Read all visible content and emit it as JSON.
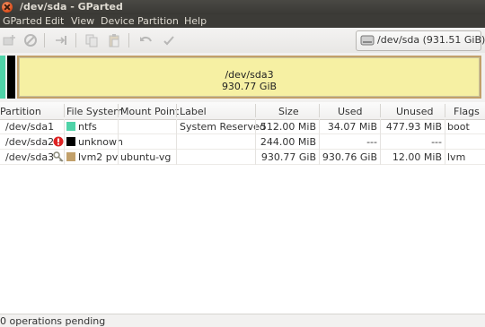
{
  "window": {
    "title": "/dev/sda - GParted"
  },
  "menu": [
    "GParted",
    "Edit",
    "View",
    "Device",
    "Partition",
    "Help"
  ],
  "toolbar": {
    "icons": [
      "new-partition-icon",
      "delete-icon",
      "resize-move-icon",
      "copy-icon",
      "paste-icon",
      "undo-icon",
      "apply-icon"
    ],
    "device_selector": "/dev/sda   (931.51 GiB)"
  },
  "disk_graphic": {
    "main_label": "/dev/sda3",
    "main_size": "930.77 GiB",
    "colors": {
      "ntfs": "#4fd3a8",
      "unknown": "#000000",
      "lvm2": "#c2a06a",
      "used_fill": "#f6f0a3"
    }
  },
  "table": {
    "headers": [
      "Partition",
      "File System",
      "Mount Point",
      "Label",
      "Size",
      "Used",
      "Unused",
      "Flags"
    ],
    "rows": [
      {
        "partition": "/dev/sda1",
        "status_icon": "",
        "fs_color": "#4fd3a8",
        "filesystem": "ntfs",
        "mount": "",
        "label": "System Reserved",
        "size": "512.00 MiB",
        "used": "34.07 MiB",
        "unused": "477.93 MiB",
        "flags": "boot"
      },
      {
        "partition": "/dev/sda2",
        "status_icon": "error-icon",
        "fs_color": "#000000",
        "filesystem": "unknown",
        "mount": "",
        "label": "",
        "size": "244.00 MiB",
        "used": "---",
        "unused": "---",
        "flags": ""
      },
      {
        "partition": "/dev/sda3",
        "status_icon": "key-icon",
        "fs_color": "#c2a06a",
        "filesystem": "lvm2 pv",
        "mount": "ubuntu-vg",
        "label": "",
        "size": "930.77 GiB",
        "used": "930.76 GiB",
        "unused": "12.00 MiB",
        "flags": "lvm"
      }
    ]
  },
  "status": {
    "text": "0 operations pending"
  }
}
